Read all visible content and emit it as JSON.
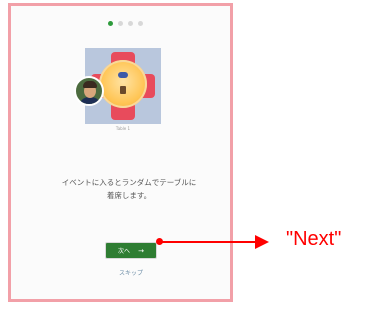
{
  "pagination": {
    "active_index": 0,
    "count": 4
  },
  "illustration": {
    "caption": "Table 1"
  },
  "content": {
    "line1": "イベントに入るとランダムでテーブルに",
    "line2": "着席します。"
  },
  "actions": {
    "next_label": "次へ",
    "next_arrow": "→",
    "skip_label": "スキップ"
  },
  "annotation": {
    "text": "\"Next\""
  },
  "colors": {
    "frame": "#f2a0a8",
    "button": "#2e7d32",
    "arrow": "#ff0000",
    "table_arms": "#e84b5c",
    "table_bg": "#b9c7dd"
  }
}
